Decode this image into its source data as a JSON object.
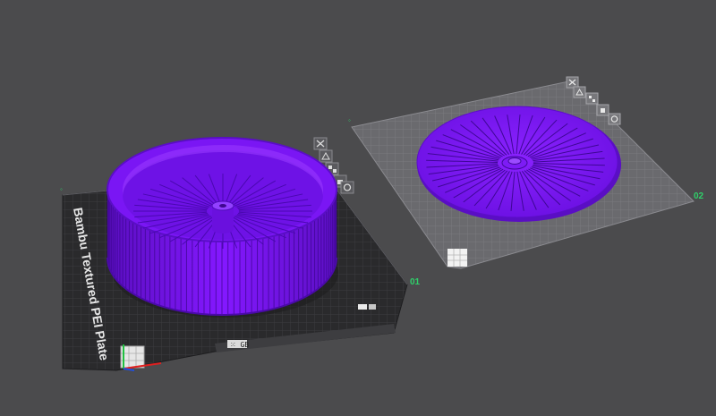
{
  "viewport": {
    "background": "#4b4b4d",
    "accent_model": "#7a12f2"
  },
  "plates": [
    {
      "id": "plate-01",
      "number": "01",
      "label": "Bambu Textured PEI Plate",
      "state": "active",
      "number_color": "#2fd06a"
    },
    {
      "id": "plate-02",
      "number": "02",
      "label": "",
      "state": "inactive",
      "number_color": "#2fd06a"
    }
  ],
  "plate_toolbar_icons": [
    "close-icon",
    "auto-orient-icon",
    "arrange-icon",
    "lock-icon",
    "settings-icon"
  ],
  "models": [
    {
      "name": "bowl-model",
      "on_plate": "01"
    },
    {
      "name": "lid-disc-model",
      "on_plate": "02"
    }
  ],
  "bottom_bar_text": "⁙ GB"
}
